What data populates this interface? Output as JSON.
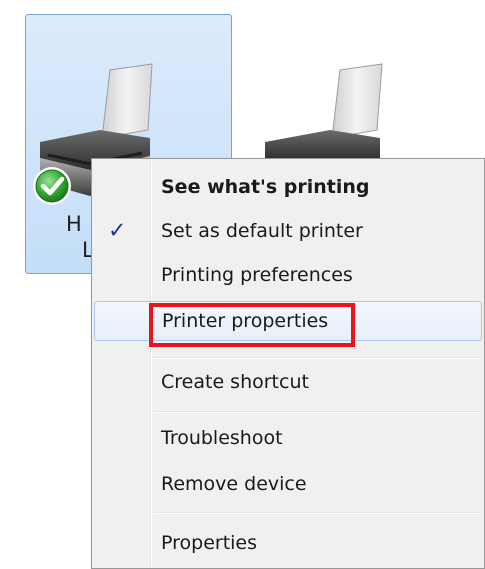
{
  "printers": [
    {
      "label": "H",
      "label_line2": "L",
      "selected": true,
      "is_default": true
    },
    {
      "label": "",
      "selected": false,
      "is_default": false
    }
  ],
  "context_menu": {
    "items": [
      {
        "label": "See what's printing",
        "bold": true,
        "checked": false
      },
      {
        "label": "Set as default printer",
        "bold": false,
        "checked": true
      },
      {
        "label": "Printing preferences",
        "bold": false,
        "checked": false
      },
      {
        "label": "Printer properties",
        "bold": false,
        "checked": false,
        "hovered": true,
        "annotated": true
      },
      {
        "label": "Create shortcut",
        "bold": false,
        "checked": false
      },
      {
        "label": "Troubleshoot",
        "bold": false,
        "checked": false
      },
      {
        "label": "Remove device",
        "bold": false,
        "checked": false
      },
      {
        "label": "Properties",
        "bold": false,
        "checked": false
      }
    ],
    "check_glyph": "✓"
  },
  "colors": {
    "selection_tile": "#c4def8",
    "annotation_red": "#e8141c",
    "menu_background": "#f0f0f0",
    "default_badge": "#2fa82f"
  }
}
